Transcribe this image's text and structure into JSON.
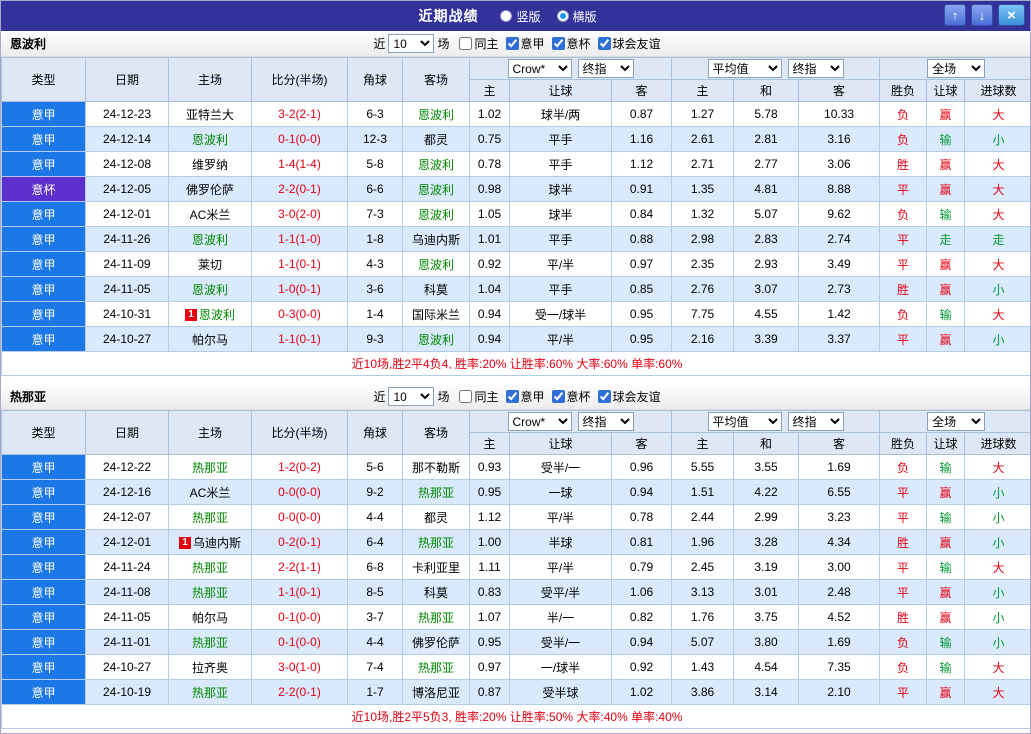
{
  "titlebar": {
    "title": "近期战绩",
    "vertical_label": "竖版",
    "horizontal_label": "横版",
    "selected_layout": "横版",
    "up_icon": "↑",
    "down_icon": "↓",
    "close_icon": "×"
  },
  "filter": {
    "prefix": "近",
    "count_value": "10",
    "suffix": "场",
    "checkboxes": [
      {
        "key": "same-home",
        "label": "同主",
        "checked": false
      },
      {
        "key": "serie-a",
        "label": "意甲",
        "checked": true
      },
      {
        "key": "coppa-italia",
        "label": "意杯",
        "checked": true
      },
      {
        "key": "club-friendly",
        "label": "球会友谊",
        "checked": true
      }
    ]
  },
  "columns": {
    "type": "类型",
    "date": "日期",
    "home": "主场",
    "score": "比分(半场)",
    "corner": "角球",
    "away": "客场",
    "odds_home": "主",
    "odds_handicap": "让球",
    "odds_away": "客",
    "euro_home": "主",
    "euro_draw": "和",
    "euro_away": "客",
    "result": "胜负",
    "handicap_result": "让球",
    "goals": "进球数"
  },
  "selects": {
    "asian_source": "Crow*",
    "asian_stage": "终指",
    "euro_source": "平均值",
    "euro_stage": "终指",
    "scope": "全场"
  },
  "league_colors": {
    "意甲": "#1b78e6",
    "意杯": "#5c2fce"
  },
  "css_colors": {
    "titlebar-bg": "#32329a",
    "red": "#e60012",
    "green": "#009933",
    "focus": "#008800",
    "row-alt": "#d8eafc"
  },
  "sections": [
    {
      "team": "恩波利",
      "summary": "近10场,胜2平4负4, 胜率:20% 让胜率:60% 大率:60% 单率:60%",
      "rows": [
        {
          "league": "意甲",
          "date": "24-12-23",
          "home": "亚特兰大",
          "home_focus": false,
          "home_badge": "",
          "score": "3-2(2-1)",
          "corner": "6-3",
          "away": "恩波利",
          "away_focus": true,
          "away_badge": "",
          "ah_home": "1.02",
          "ah_line": "球半/两",
          "ah_away": "0.87",
          "eu_home": "1.27",
          "eu_draw": "5.78",
          "eu_away": "10.33",
          "result": "负",
          "ah_result": "赢",
          "goal_result": "大"
        },
        {
          "league": "意甲",
          "date": "24-12-14",
          "home": "恩波利",
          "home_focus": true,
          "home_badge": "",
          "score": "0-1(0-0)",
          "corner": "12-3",
          "away": "都灵",
          "away_focus": false,
          "away_badge": "",
          "ah_home": "0.75",
          "ah_line": "平手",
          "ah_away": "1.16",
          "eu_home": "2.61",
          "eu_draw": "2.81",
          "eu_away": "3.16",
          "result": "负",
          "ah_result": "输",
          "goal_result": "小"
        },
        {
          "league": "意甲",
          "date": "24-12-08",
          "home": "维罗纳",
          "home_focus": false,
          "home_badge": "",
          "score": "1-4(1-4)",
          "corner": "5-8",
          "away": "恩波利",
          "away_focus": true,
          "away_badge": "",
          "ah_home": "0.78",
          "ah_line": "平手",
          "ah_away": "1.12",
          "eu_home": "2.71",
          "eu_draw": "2.77",
          "eu_away": "3.06",
          "result": "胜",
          "ah_result": "赢",
          "goal_result": "大"
        },
        {
          "league": "意杯",
          "date": "24-12-05",
          "home": "佛罗伦萨",
          "home_focus": false,
          "home_badge": "",
          "score": "2-2(0-1)",
          "corner": "6-6",
          "away": "恩波利",
          "away_focus": true,
          "away_badge": "",
          "ah_home": "0.98",
          "ah_line": "球半",
          "ah_away": "0.91",
          "eu_home": "1.35",
          "eu_draw": "4.81",
          "eu_away": "8.88",
          "result": "平",
          "ah_result": "赢",
          "goal_result": "大"
        },
        {
          "league": "意甲",
          "date": "24-12-01",
          "home": "AC米兰",
          "home_focus": false,
          "home_badge": "",
          "score": "3-0(2-0)",
          "corner": "7-3",
          "away": "恩波利",
          "away_focus": true,
          "away_badge": "",
          "ah_home": "1.05",
          "ah_line": "球半",
          "ah_away": "0.84",
          "eu_home": "1.32",
          "eu_draw": "5.07",
          "eu_away": "9.62",
          "result": "负",
          "ah_result": "输",
          "goal_result": "大"
        },
        {
          "league": "意甲",
          "date": "24-11-26",
          "home": "恩波利",
          "home_focus": true,
          "home_badge": "",
          "score": "1-1(1-0)",
          "corner": "1-8",
          "away": "乌迪内斯",
          "away_focus": false,
          "away_badge": "",
          "ah_home": "1.01",
          "ah_line": "平手",
          "ah_away": "0.88",
          "eu_home": "2.98",
          "eu_draw": "2.83",
          "eu_away": "2.74",
          "result": "平",
          "ah_result": "走",
          "goal_result": "走"
        },
        {
          "league": "意甲",
          "date": "24-11-09",
          "home": "莱切",
          "home_focus": false,
          "home_badge": "",
          "score": "1-1(0-1)",
          "corner": "4-3",
          "away": "恩波利",
          "away_focus": true,
          "away_badge": "",
          "ah_home": "0.92",
          "ah_line": "平/半",
          "ah_away": "0.97",
          "eu_home": "2.35",
          "eu_draw": "2.93",
          "eu_away": "3.49",
          "result": "平",
          "ah_result": "赢",
          "goal_result": "大"
        },
        {
          "league": "意甲",
          "date": "24-11-05",
          "home": "恩波利",
          "home_focus": true,
          "home_badge": "",
          "score": "1-0(0-1)",
          "corner": "3-6",
          "away": "科莫",
          "away_focus": false,
          "away_badge": "",
          "ah_home": "1.04",
          "ah_line": "平手",
          "ah_away": "0.85",
          "eu_home": "2.76",
          "eu_draw": "3.07",
          "eu_away": "2.73",
          "result": "胜",
          "ah_result": "赢",
          "goal_result": "小"
        },
        {
          "league": "意甲",
          "date": "24-10-31",
          "home": "恩波利",
          "home_focus": true,
          "home_badge": "1",
          "score": "0-3(0-0)",
          "corner": "1-4",
          "away": "国际米兰",
          "away_focus": false,
          "away_badge": "",
          "ah_home": "0.94",
          "ah_line": "受一/球半",
          "ah_away": "0.95",
          "eu_home": "7.75",
          "eu_draw": "4.55",
          "eu_away": "1.42",
          "result": "负",
          "ah_result": "输",
          "goal_result": "大"
        },
        {
          "league": "意甲",
          "date": "24-10-27",
          "home": "帕尔马",
          "home_focus": false,
          "home_badge": "",
          "score": "1-1(0-1)",
          "corner": "9-3",
          "away": "恩波利",
          "away_focus": true,
          "away_badge": "",
          "ah_home": "0.94",
          "ah_line": "平/半",
          "ah_away": "0.95",
          "eu_home": "2.16",
          "eu_draw": "3.39",
          "eu_away": "3.37",
          "result": "平",
          "ah_result": "赢",
          "goal_result": "小"
        }
      ]
    },
    {
      "team": "热那亚",
      "summary": "近10场,胜2平5负3, 胜率:20% 让胜率:50% 大率:40% 单率:40%",
      "rows": [
        {
          "league": "意甲",
          "date": "24-12-22",
          "home": "热那亚",
          "home_focus": true,
          "home_badge": "",
          "score": "1-2(0-2)",
          "corner": "5-6",
          "away": "那不勒斯",
          "away_focus": false,
          "away_badge": "",
          "ah_home": "0.93",
          "ah_line": "受半/一",
          "ah_away": "0.96",
          "eu_home": "5.55",
          "eu_draw": "3.55",
          "eu_away": "1.69",
          "result": "负",
          "ah_result": "输",
          "goal_result": "大"
        },
        {
          "league": "意甲",
          "date": "24-12-16",
          "home": "AC米兰",
          "home_focus": false,
          "home_badge": "",
          "score": "0-0(0-0)",
          "corner": "9-2",
          "away": "热那亚",
          "away_focus": true,
          "away_badge": "",
          "ah_home": "0.95",
          "ah_line": "一球",
          "ah_away": "0.94",
          "eu_home": "1.51",
          "eu_draw": "4.22",
          "eu_away": "6.55",
          "result": "平",
          "ah_result": "赢",
          "goal_result": "小"
        },
        {
          "league": "意甲",
          "date": "24-12-07",
          "home": "热那亚",
          "home_focus": true,
          "home_badge": "",
          "score": "0-0(0-0)",
          "corner": "4-4",
          "away": "都灵",
          "away_focus": false,
          "away_badge": "",
          "ah_home": "1.12",
          "ah_line": "平/半",
          "ah_away": "0.78",
          "eu_home": "2.44",
          "eu_draw": "2.99",
          "eu_away": "3.23",
          "result": "平",
          "ah_result": "输",
          "goal_result": "小"
        },
        {
          "league": "意甲",
          "date": "24-12-01",
          "home": "乌迪内斯",
          "home_focus": false,
          "home_badge": "1",
          "score": "0-2(0-1)",
          "corner": "6-4",
          "away": "热那亚",
          "away_focus": true,
          "away_badge": "",
          "ah_home": "1.00",
          "ah_line": "半球",
          "ah_away": "0.81",
          "eu_home": "1.96",
          "eu_draw": "3.28",
          "eu_away": "4.34",
          "result": "胜",
          "ah_result": "赢",
          "goal_result": "小"
        },
        {
          "league": "意甲",
          "date": "24-11-24",
          "home": "热那亚",
          "home_focus": true,
          "home_badge": "",
          "score": "2-2(1-1)",
          "corner": "6-8",
          "away": "卡利亚里",
          "away_focus": false,
          "away_badge": "",
          "ah_home": "1.11",
          "ah_line": "平/半",
          "ah_away": "0.79",
          "eu_home": "2.45",
          "eu_draw": "3.19",
          "eu_away": "3.00",
          "result": "平",
          "ah_result": "输",
          "goal_result": "大"
        },
        {
          "league": "意甲",
          "date": "24-11-08",
          "home": "热那亚",
          "home_focus": true,
          "home_badge": "",
          "score": "1-1(0-1)",
          "corner": "8-5",
          "away": "科莫",
          "away_focus": false,
          "away_badge": "",
          "ah_home": "0.83",
          "ah_line": "受平/半",
          "ah_away": "1.06",
          "eu_home": "3.13",
          "eu_draw": "3.01",
          "eu_away": "2.48",
          "result": "平",
          "ah_result": "赢",
          "goal_result": "小"
        },
        {
          "league": "意甲",
          "date": "24-11-05",
          "home": "帕尔马",
          "home_focus": false,
          "home_badge": "",
          "score": "0-1(0-0)",
          "corner": "3-7",
          "away": "热那亚",
          "away_focus": true,
          "away_badge": "",
          "ah_home": "1.07",
          "ah_line": "半/一",
          "ah_away": "0.82",
          "eu_home": "1.76",
          "eu_draw": "3.75",
          "eu_away": "4.52",
          "result": "胜",
          "ah_result": "赢",
          "goal_result": "小"
        },
        {
          "league": "意甲",
          "date": "24-11-01",
          "home": "热那亚",
          "home_focus": true,
          "home_badge": "",
          "score": "0-1(0-0)",
          "corner": "4-4",
          "away": "佛罗伦萨",
          "away_focus": false,
          "away_badge": "",
          "ah_home": "0.95",
          "ah_line": "受半/一",
          "ah_away": "0.94",
          "eu_home": "5.07",
          "eu_draw": "3.80",
          "eu_away": "1.69",
          "result": "负",
          "ah_result": "输",
          "goal_result": "小"
        },
        {
          "league": "意甲",
          "date": "24-10-27",
          "home": "拉齐奥",
          "home_focus": false,
          "home_badge": "",
          "score": "3-0(1-0)",
          "corner": "7-4",
          "away": "热那亚",
          "away_focus": true,
          "away_badge": "",
          "ah_home": "0.97",
          "ah_line": "一/球半",
          "ah_away": "0.92",
          "eu_home": "1.43",
          "eu_draw": "4.54",
          "eu_away": "7.35",
          "result": "负",
          "ah_result": "输",
          "goal_result": "大"
        },
        {
          "league": "意甲",
          "date": "24-10-19",
          "home": "热那亚",
          "home_focus": true,
          "home_badge": "",
          "score": "2-2(0-1)",
          "corner": "1-7",
          "away": "博洛尼亚",
          "away_focus": false,
          "away_badge": "",
          "ah_home": "0.87",
          "ah_line": "受半球",
          "ah_away": "1.02",
          "eu_home": "3.86",
          "eu_draw": "3.14",
          "eu_away": "2.10",
          "result": "平",
          "ah_result": "赢",
          "goal_result": "大"
        }
      ]
    }
  ]
}
